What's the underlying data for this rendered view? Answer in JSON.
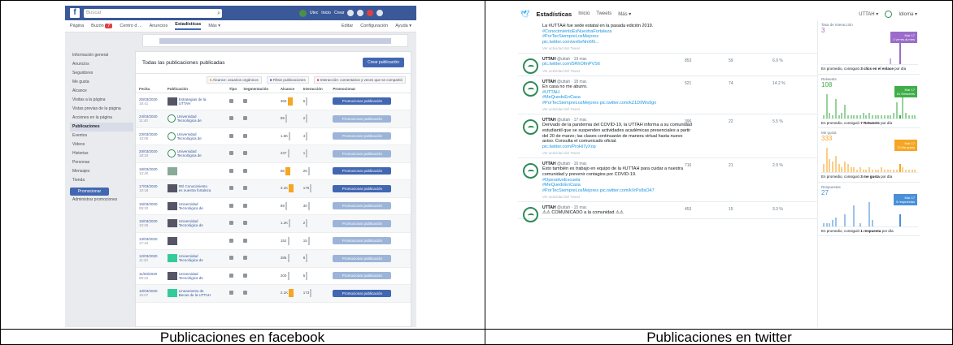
{
  "captions": {
    "facebook": "Publicaciones en facebook",
    "twitter": "Publicaciones en twitter"
  },
  "colors": {
    "facebook_blue": "#3b5998",
    "twitter_blue": "#1da1f2",
    "impressions": "#9b6cc9",
    "followers": "#3fae49",
    "likes": "#f5a623",
    "replies": "#4a90d9"
  },
  "facebook": {
    "search_placeholder": "Buscar",
    "search_icon": "search-icon",
    "user_name": "Utec",
    "top_links": [
      "Inicio",
      "Crear"
    ],
    "nav": {
      "items": [
        "Página",
        "Buzón",
        "Centro d ...",
        "Anuncios",
        "Estadísticas",
        "Más ▾"
      ],
      "badge": "7",
      "right": [
        "Editar",
        "Configuración",
        "Ayuda ▾"
      ]
    },
    "sidebar": {
      "items": [
        "Información general",
        "Anuncios",
        "Seguidores",
        "Me gusta",
        "Alcance",
        "Visitas a la página",
        "Vistas previas de la página",
        "Acciones en la página",
        "Publicaciones",
        "Eventos",
        "Videos",
        "Historias",
        "Personas",
        "Mensajes",
        "Tienda"
      ],
      "selected": "Publicaciones",
      "promote": "Promocionar",
      "promote_hint": "Administrar promociones"
    },
    "main": {
      "title": "Todas las publicaciones publicadas",
      "create_button": "Crear publicación",
      "filters": [
        "Alcance: usuarios orgánicos",
        "Filtrar publicaciones",
        "Interacción: comentarios y veces que se compartió"
      ],
      "columns": [
        "Fecha",
        "Publicación",
        "Tipo",
        "Segmentación",
        "Alcance",
        "Interacción",
        "Promocionar"
      ],
      "promote_label": "Promocionar publicación",
      "rows": [
        {
          "date": "25/03/2020",
          "time": "18:41",
          "title": "Estrategias de la UTTAH",
          "thumb": "dark",
          "reach": "360",
          "eng": "6",
          "promoted": true
        },
        {
          "date": "24/03/2020",
          "time": "11:40",
          "title": "Universidad Tecnológica de",
          "thumb": "logo",
          "reach": "89",
          "eng": "2",
          "promoted": false
        },
        {
          "date": "23/03/2020",
          "time": "10:05",
          "title": "Universidad Tecnológica de",
          "thumb": "logo",
          "reach": "1.6K",
          "eng": "4",
          "promoted": false
        },
        {
          "date": "20/03/2020",
          "time": "18:23",
          "title": "Universidad Tecnológica de",
          "thumb": "logo",
          "reach": "237",
          "eng": "1",
          "promoted": false
        },
        {
          "date": "18/03/2020",
          "time": "13:40",
          "title": "",
          "thumb": "plain",
          "reach": "66",
          "eng": "26",
          "promoted": true
        },
        {
          "date": "17/03/2020",
          "time": "10:18",
          "title": "#El Conocimiento es nuestra fortaleza",
          "thumb": "dark",
          "reach": "3.1K",
          "eng": "176",
          "promoted": true
        },
        {
          "date": "16/03/2020",
          "time": "09:32",
          "title": "Universidad Tecnológica de",
          "thumb": "dark",
          "reach": "89",
          "eng": "30",
          "promoted": false
        },
        {
          "date": "15/03/2020",
          "time": "10:25",
          "title": "Universidad Tecnológica de",
          "thumb": "dark",
          "reach": "1.2K",
          "eng": "2",
          "promoted": false
        },
        {
          "date": "13/03/2020",
          "time": "17:44",
          "title": "",
          "thumb": "dark",
          "reach": "152",
          "eng": "15",
          "promoted": false
        },
        {
          "date": "12/03/2020",
          "time": "11:33",
          "title": "Universidad Tecnológica de",
          "thumb": "green",
          "reach": "385",
          "eng": "8",
          "promoted": false
        },
        {
          "date": "11/03/2020",
          "time": "09:22",
          "title": "Universidad Tecnológica de",
          "thumb": "dark",
          "reach": "200",
          "eng": "5",
          "promoted": false
        },
        {
          "date": "10/03/2020",
          "time": "15:07",
          "title": "Lineamiento de Becas de la UTTAH",
          "thumb": "green",
          "reach": "2.1K",
          "eng": "173",
          "promoted": true
        }
      ]
    }
  },
  "twitter": {
    "brand": "Estadísticas",
    "tabs": [
      "Inicio",
      "Tweets",
      "Más ▾"
    ],
    "account": "UTTAH ▾",
    "lang": "Idioma ▾",
    "tweets": [
      {
        "top": true,
        "text": "La #UTTAH fue sede estatal en la pasada edición 2019.",
        "links": [
          "#ConocimientoEsNuestraFortaleza",
          "#PorTecSiempreLosMejores",
          "pic.twitter.com/wx6eNm6N..."
        ],
        "meta": "Ver actividad del Tweet"
      },
      {
        "user": "UTTAH",
        "handle": "@uttah · 19 mar.",
        "text": "",
        "links": [
          "pic.twitter.com/5RhOfmPVS6"
        ],
        "meta": "Ver actividad del Tweet",
        "impressions": "853",
        "engagements": "59",
        "rate": "6.9 %"
      },
      {
        "user": "UTTAH",
        "handle": "@uttah · 18 mar.",
        "text": "En casa no me aburro.",
        "links": [
          "#UTTAH",
          "#MeQuedoEnCasa",
          "#PorTecSiempreLosMejores pic.twitter.com/kZ1D9Ws9gn"
        ],
        "meta": "Ver actividad del Tweet",
        "impressions": "521",
        "engagements": "74",
        "rate": "14.2 %"
      },
      {
        "user": "UTTAH",
        "handle": "@uttah · 17 mar.",
        "text": "Derivado de la pandemia del COVID-19, la UTTAH informa a su comunidad estudiantil que se suspenden actividades académicas presenciales a partir del 20 de marzo; las clases continuarán de manera virtual hasta nuevo aviso. Consulta el comunicado oficial.",
        "links": [
          "pic.twitter.com/ProHi7yXnp"
        ],
        "meta": "Ver actividad del Tweet",
        "impressions": "396",
        "engagements": "22",
        "rate": "5.5 %"
      },
      {
        "user": "UTTAH",
        "handle": "@uttah · 16 mar.",
        "text": "Esto también es trabajo en equipo de la #UTTAH para cuidar a nuestra comunidad y prevenir contagios por COVID-19.",
        "links": [
          "#OperativoEscuela",
          "#MeQuedoEnCasa",
          "#PorTecSiempreLosMejores pic.twitter.com/kVrPx8sO47"
        ],
        "meta": "Ver actividad del Tweet",
        "impressions": "716",
        "engagements": "21",
        "rate": "2.9 %"
      },
      {
        "user": "UTTAH",
        "handle": "@uttah · 15 mar.",
        "text": "⚠⚠ COMUNICADO a la comunidad ⚠⚠",
        "links": [],
        "meta": "",
        "impressions": "453",
        "engagements": "15",
        "rate": "3.3 %"
      }
    ],
    "sidebar": [
      {
        "label": "Tasa de interacción",
        "value": "3",
        "chip": "Mar 17\n2 veces al mes",
        "note_prefix": "En promedio, consiguió",
        "note_bold": "3 clics en el enlace",
        "note_suffix": "por día",
        "color_key": "impressions",
        "bars": [
          0,
          0,
          0,
          0,
          0,
          0,
          0,
          0,
          0,
          0,
          0,
          0,
          0,
          0,
          0,
          0,
          0,
          0,
          0,
          0,
          0,
          0,
          2,
          0,
          0,
          9,
          0,
          0,
          0,
          0,
          0
        ]
      },
      {
        "label": "Retweets",
        "value": "108",
        "chip": "Mar 17\n61 Retweets",
        "note_prefix": "En promedio, consiguió",
        "note_bold": "7 Retweets",
        "note_suffix": "por día",
        "color_key": "followers",
        "bars": [
          1,
          9,
          2,
          1,
          7,
          1,
          2,
          5,
          1,
          1,
          1,
          1,
          1,
          2,
          1,
          2,
          1,
          1,
          1,
          1,
          1,
          1,
          1,
          2,
          6,
          1,
          8,
          2,
          1,
          1,
          1
        ]
      },
      {
        "label": "Me gusta",
        "value": "333",
        "chip": "Mar 17\n73 Me gusta",
        "note_prefix": "En promedio, consiguió",
        "note_bold": "3 me gusta",
        "note_suffix": "por día",
        "color_key": "likes",
        "bars": [
          3,
          9,
          5,
          4,
          6,
          3,
          2,
          4,
          3,
          2,
          2,
          1,
          2,
          1,
          1,
          2,
          1,
          1,
          1,
          2,
          1,
          1,
          1,
          1,
          1,
          3,
          2,
          1,
          1,
          1,
          1
        ]
      },
      {
        "label": "Respuestas",
        "value": "27",
        "chip": "Mar 17\n5 respuestas",
        "note_prefix": "En promedio, consiguió",
        "note_bold": "1 respuesta",
        "note_suffix": "por día",
        "color_key": "replies",
        "bars": [
          1,
          1,
          1,
          2,
          3,
          0,
          0,
          4,
          0,
          0,
          7,
          0,
          1,
          0,
          0,
          8,
          2,
          0,
          0,
          0,
          0,
          0,
          0,
          0,
          0,
          4,
          0,
          0,
          0,
          0,
          0
        ]
      }
    ]
  }
}
